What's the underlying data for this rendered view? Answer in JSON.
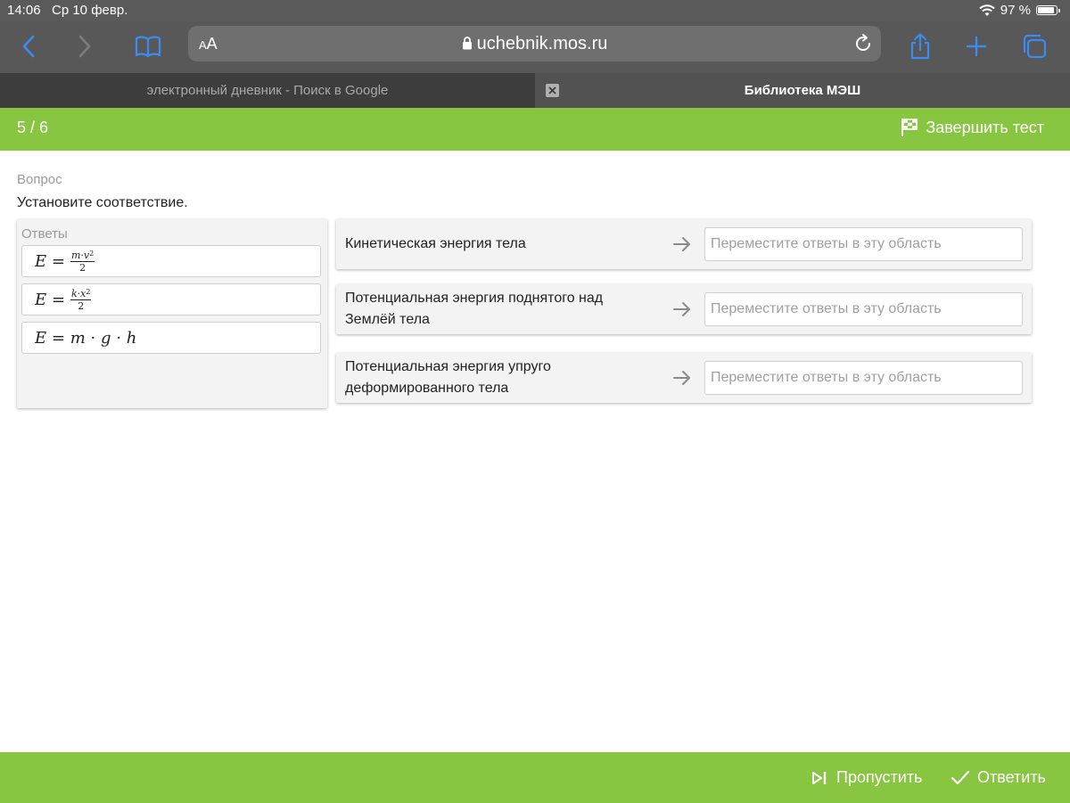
{
  "status": {
    "time": "14:06",
    "date": "Ср 10 февр.",
    "battery": "97 %",
    "battery_level": 0.97
  },
  "browser": {
    "aa_small": "A",
    "aa_big": "A",
    "url": "uchebnik.mos.ru",
    "tabs": [
      {
        "title": "электронный дневник - Поиск в Google"
      },
      {
        "title": "Библиотека МЭШ"
      }
    ],
    "icons": [
      "back-icon",
      "forward-icon",
      "bookmarks-icon",
      "lock-icon",
      "reload-icon",
      "share-icon",
      "new-tab-icon",
      "tabs-icon"
    ]
  },
  "header": {
    "progress": "5 / 6",
    "finish_label": "Завершить тест"
  },
  "question": {
    "label": "Вопрос",
    "text": "Установите соответствие."
  },
  "answers": {
    "title": "Ответы",
    "items": [
      {
        "lhs": "E",
        "eq": "=",
        "num_a": "m",
        "num_dot": "·",
        "num_b": "v",
        "num_exp": "2",
        "den": "2"
      },
      {
        "lhs": "E",
        "eq": "=",
        "num_a": "k",
        "num_dot": "·",
        "num_b": "x",
        "num_exp": "2",
        "den": "2"
      },
      {
        "lhs": "E",
        "eq": "=",
        "m": "m",
        "dot1": "·",
        "g": "g",
        "dot2": "·",
        "h": "h"
      }
    ]
  },
  "matches": [
    {
      "line1": "Кинетическая энергия тела",
      "line2": "",
      "placeholder": "Переместите ответы в эту область"
    },
    {
      "line1": "Потенциальная энергия поднятого над",
      "line2": "Землёй тела",
      "placeholder": "Переместите ответы в эту область"
    },
    {
      "line1": "Потенциальная энергия упруго",
      "line2": "деформированного тела",
      "placeholder": "Переместите ответы в эту область"
    }
  ],
  "footer": {
    "skip_label": "Пропустить",
    "answer_label": "Ответить"
  },
  "colors": {
    "accent_green": "#88c541",
    "ios_blue": "#3b8cf0",
    "toolbar_gray": "#585858"
  }
}
